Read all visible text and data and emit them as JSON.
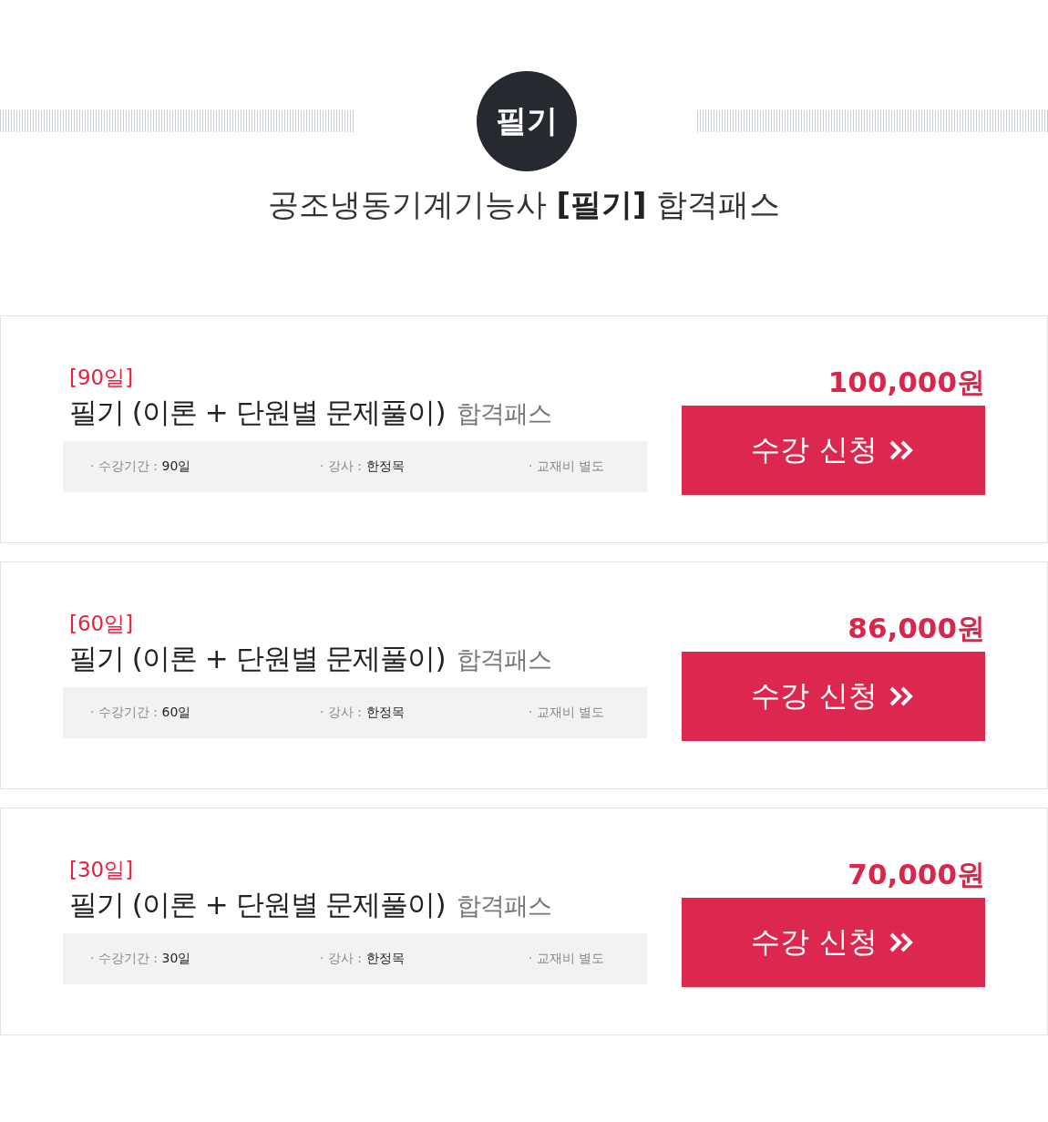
{
  "header": {
    "badge": "필기",
    "title": "공조냉동기계기능사 **[필기]** 합격패스"
  },
  "courses": [
    {
      "period": "[90일]",
      "name": "필기 (이론 + 단원별 문제풀이)",
      "suffix": "합격패스",
      "info": [
        {
          "label": "· 수강기간 :",
          "value": "90일"
        },
        {
          "label": "· 강사 :",
          "value": "한정목"
        },
        {
          "label": "· 교재비 별도"
        }
      ],
      "price": "100,000원",
      "button": "수강 신청"
    },
    {
      "period": "[60일]",
      "name": "필기 (이론 + 단원별 문제풀이)",
      "suffix": "합격패스",
      "info": [
        {
          "label": "· 수강기간 :",
          "value": "60일"
        },
        {
          "label": "· 강사 :",
          "value": "한정목"
        },
        {
          "label": "· 교재비 별도"
        }
      ],
      "price": "86,000원",
      "button": "수강 신청"
    },
    {
      "period": "[30일]",
      "name": "필기 (이론 + 단원별 문제풀이)",
      "suffix": "합격패스",
      "info": [
        {
          "label": "· 수강기간 :",
          "value": "30일"
        },
        {
          "label": "· 강사 :",
          "value": "한정목"
        },
        {
          "label": "· 교재비 별도"
        }
      ],
      "price": "70,000원",
      "button": "수강 신청"
    }
  ]
}
